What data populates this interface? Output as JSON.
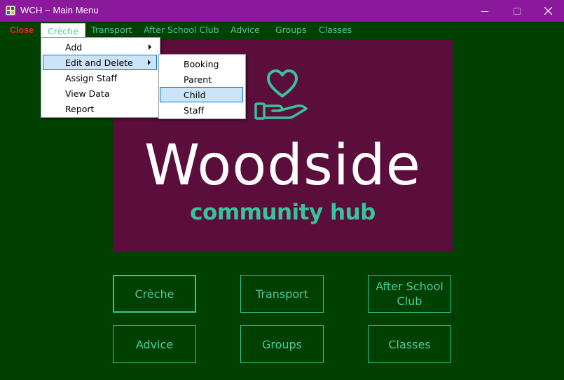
{
  "window": {
    "title": "WCH ~ Main Menu",
    "titlebar_color": "#8a1a9b",
    "background_color": "#004000",
    "controls": [
      "minimize-icon",
      "maximize-icon",
      "close-icon"
    ]
  },
  "menubar": {
    "close_label": "Close",
    "items": [
      "Crèche",
      "Transport",
      "After School Club",
      "Advice",
      "Groups",
      "Classes"
    ]
  },
  "creche_menu": {
    "items": [
      "Add",
      "Edit and Delete",
      "Assign Staff",
      "View Data",
      "Report"
    ],
    "highlighted": "Edit and Delete"
  },
  "edit_delete_submenu": {
    "items": [
      "Booking",
      "Parent",
      "Child",
      "Staff"
    ],
    "highlighted": "Child"
  },
  "logo": {
    "title": "Woodside",
    "subtitle": "community hub",
    "background_color": "#5b0e3c",
    "accent_color": "#38c49a"
  },
  "buttons": {
    "creche": "Crèche",
    "transport": "Transport",
    "after_school": "After School Club",
    "advice": "Advice",
    "groups": "Groups",
    "classes": "Classes"
  }
}
